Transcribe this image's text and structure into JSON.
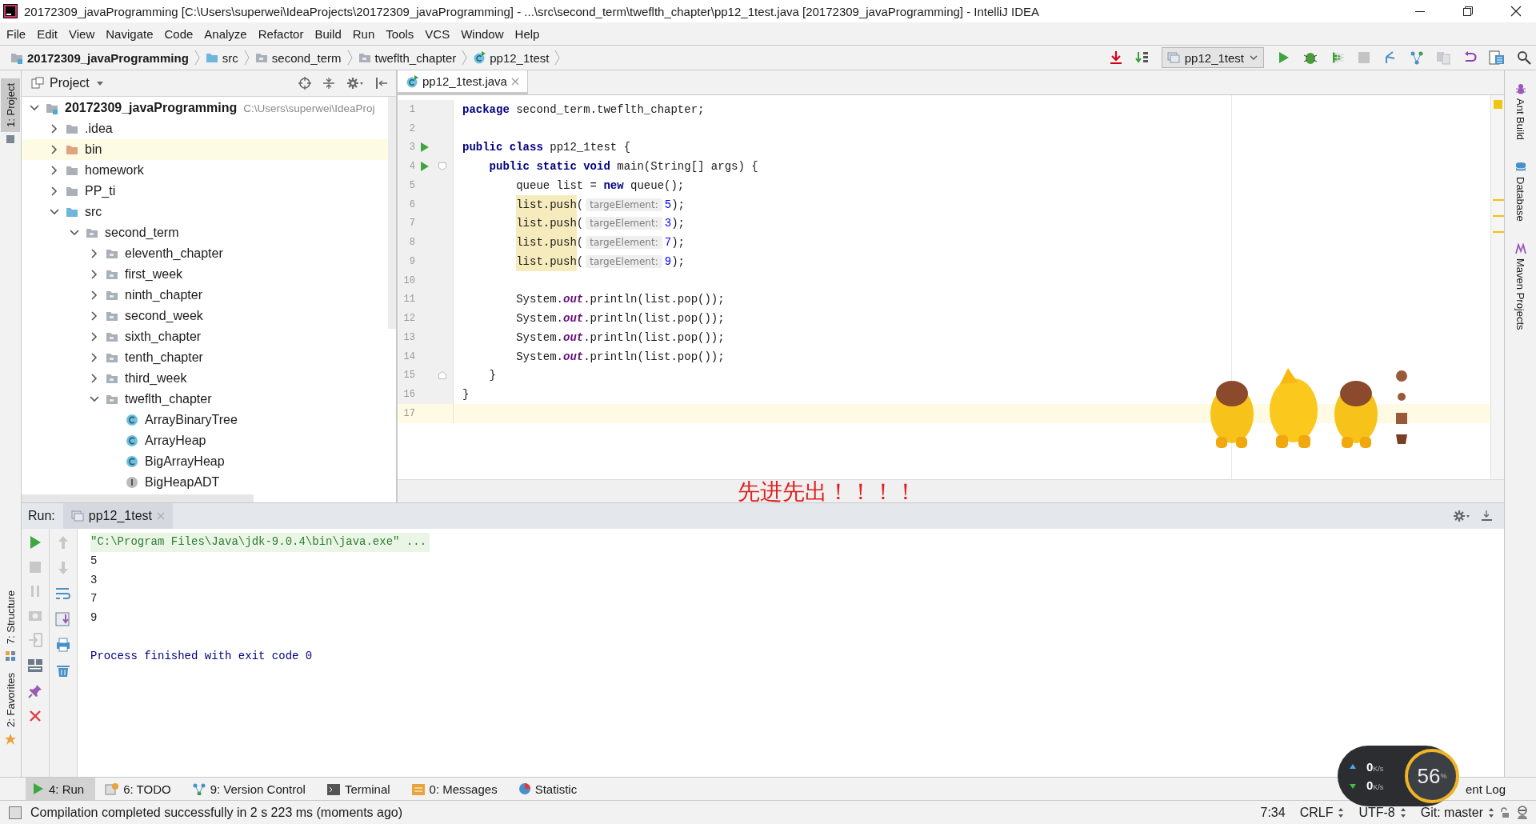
{
  "window": {
    "title": "20172309_javaProgramming [C:\\Users\\superwei\\IdeaProjects\\20172309_javaProgramming] - ...\\src\\second_term\\tweflth_chapter\\pp12_1test.java [20172309_javaProgramming] - IntelliJ IDEA"
  },
  "menu": [
    "File",
    "Edit",
    "View",
    "Navigate",
    "Code",
    "Analyze",
    "Refactor",
    "Build",
    "Run",
    "Tools",
    "VCS",
    "Window",
    "Help"
  ],
  "breadcrumbs": [
    {
      "label": "20172309_javaProgramming",
      "kind": "project"
    },
    {
      "label": "src",
      "kind": "source"
    },
    {
      "label": "second_term",
      "kind": "package"
    },
    {
      "label": "tweflth_chapter",
      "kind": "package"
    },
    {
      "label": "pp12_1test",
      "kind": "class"
    }
  ],
  "run_config": {
    "label": "pp12_1test"
  },
  "left_strip": [
    {
      "label": "1: Project",
      "selected": true,
      "kind": "top"
    },
    {
      "label": "7: Structure",
      "selected": false,
      "kind": "bottom"
    },
    {
      "label": "2: Favorites",
      "selected": false,
      "kind": "bottom"
    }
  ],
  "project_panel": {
    "title": "Project",
    "tree": [
      {
        "label": "20172309_javaProgramming",
        "kind": "module",
        "path": "C:\\Users\\superwei\\IdeaProj",
        "expanded": true,
        "highlighted": false,
        "children": [
          {
            "label": ".idea",
            "kind": "folder",
            "expanded": false,
            "highlighted": false
          },
          {
            "label": "bin",
            "kind": "excluded",
            "expanded": false,
            "highlighted": true
          },
          {
            "label": "homework",
            "kind": "folder",
            "expanded": false,
            "highlighted": false
          },
          {
            "label": "PP_ti",
            "kind": "folder",
            "expanded": false,
            "highlighted": false
          },
          {
            "label": "src",
            "kind": "source",
            "expanded": true,
            "highlighted": false,
            "children": [
              {
                "label": "second_term",
                "kind": "package",
                "expanded": true,
                "highlighted": false,
                "children": [
                  {
                    "label": "eleventh_chapter",
                    "kind": "package",
                    "expanded": false,
                    "highlighted": false
                  },
                  {
                    "label": "first_week",
                    "kind": "package",
                    "expanded": false,
                    "highlighted": false
                  },
                  {
                    "label": "ninth_chapter",
                    "kind": "package",
                    "expanded": false,
                    "highlighted": false
                  },
                  {
                    "label": "second_week",
                    "kind": "package",
                    "expanded": false,
                    "highlighted": false
                  },
                  {
                    "label": "sixth_chapter",
                    "kind": "package",
                    "expanded": false,
                    "highlighted": false
                  },
                  {
                    "label": "tenth_chapter",
                    "kind": "package",
                    "expanded": false,
                    "highlighted": false
                  },
                  {
                    "label": "third_week",
                    "kind": "package",
                    "expanded": false,
                    "highlighted": false
                  },
                  {
                    "label": "tweflth_chapter",
                    "kind": "package",
                    "expanded": true,
                    "highlighted": false,
                    "children": [
                      {
                        "label": "ArrayBinaryTree",
                        "kind": "class",
                        "highlighted": false
                      },
                      {
                        "label": "ArrayHeap",
                        "kind": "class",
                        "highlighted": false
                      },
                      {
                        "label": "BigArrayHeap",
                        "kind": "class",
                        "highlighted": false
                      },
                      {
                        "label": "BigHeapADT",
                        "kind": "interface",
                        "highlighted": false
                      }
                    ]
                  }
                ]
              }
            ]
          }
        ]
      }
    ]
  },
  "editor": {
    "tabs": [
      {
        "label": "pp12_1test.java",
        "selected": true
      }
    ],
    "lines": [
      {
        "number": "1",
        "run_marker": false,
        "fold": false,
        "current": false,
        "tokens": [
          {
            "kind": "keyword",
            "text": "package"
          },
          {
            "kind": "plain",
            "text": " second_term.tweflth_chapter;"
          }
        ]
      },
      {
        "number": "2",
        "run_marker": false,
        "fold": false,
        "current": false
      },
      {
        "number": "3",
        "run_marker": true,
        "fold": false,
        "current": false,
        "tokens": [
          {
            "kind": "keyword",
            "text": "public class"
          },
          {
            "kind": "plain",
            "text": " pp12_1test {"
          }
        ],
        "children": [
          {
            "number": "4",
            "run_marker": true,
            "fold": true,
            "current": false,
            "tokens": [
              {
                "kind": "keyword",
                "text": "public static void"
              },
              {
                "kind": "plain",
                "text": " main(String[] args) {"
              }
            ],
            "children": [
              {
                "number": "5",
                "run_marker": false,
                "fold": false,
                "current": false,
                "tokens": [
                  {
                    "kind": "plain",
                    "text": "queue list = "
                  },
                  {
                    "kind": "keyword",
                    "text": "new"
                  },
                  {
                    "kind": "plain",
                    "text": " queue();"
                  }
                ]
              },
              {
                "number": "6",
                "run_marker": false,
                "fold": false,
                "current": false,
                "tokens": [
                  {
                    "kind": "usage",
                    "text": "list.push"
                  },
                  {
                    "kind": "plain",
                    "text": "("
                  },
                  {
                    "kind": "hint",
                    "text": "targeElement:"
                  },
                  {
                    "kind": "number",
                    "text": "5"
                  },
                  {
                    "kind": "plain",
                    "text": ");"
                  }
                ]
              },
              {
                "number": "7",
                "run_marker": false,
                "fold": false,
                "current": false,
                "tokens": [
                  {
                    "kind": "usage",
                    "text": "list.push"
                  },
                  {
                    "kind": "plain",
                    "text": "("
                  },
                  {
                    "kind": "hint",
                    "text": "targeElement:"
                  },
                  {
                    "kind": "number",
                    "text": "3"
                  },
                  {
                    "kind": "plain",
                    "text": ");"
                  }
                ]
              },
              {
                "number": "8",
                "run_marker": false,
                "fold": false,
                "current": false,
                "tokens": [
                  {
                    "kind": "usage",
                    "text": "list.push"
                  },
                  {
                    "kind": "plain",
                    "text": "("
                  },
                  {
                    "kind": "hint",
                    "text": "targeElement:"
                  },
                  {
                    "kind": "number",
                    "text": "7"
                  },
                  {
                    "kind": "plain",
                    "text": ");"
                  }
                ]
              },
              {
                "number": "9",
                "run_marker": false,
                "fold": false,
                "current": false,
                "tokens": [
                  {
                    "kind": "usage",
                    "text": "list.push"
                  },
                  {
                    "kind": "plain",
                    "text": "("
                  },
                  {
                    "kind": "hint",
                    "text": "targeElement:"
                  },
                  {
                    "kind": "number",
                    "text": "9"
                  },
                  {
                    "kind": "plain",
                    "text": ");"
                  }
                ]
              },
              {
                "number": "10",
                "run_marker": false,
                "fold": false,
                "current": false
              },
              {
                "number": "11",
                "run_marker": false,
                "fold": false,
                "current": false,
                "tokens": [
                  {
                    "kind": "plain",
                    "text": "System."
                  },
                  {
                    "kind": "static",
                    "text": "out"
                  },
                  {
                    "kind": "plain",
                    "text": ".println(list.pop());"
                  }
                ]
              },
              {
                "number": "12",
                "run_marker": false,
                "fold": false,
                "current": false,
                "tokens": [
                  {
                    "kind": "plain",
                    "text": "System."
                  },
                  {
                    "kind": "static",
                    "text": "out"
                  },
                  {
                    "kind": "plain",
                    "text": ".println(list.pop());"
                  }
                ]
              },
              {
                "number": "13",
                "run_marker": false,
                "fold": false,
                "current": false,
                "tokens": [
                  {
                    "kind": "plain",
                    "text": "System."
                  },
                  {
                    "kind": "static",
                    "text": "out"
                  },
                  {
                    "kind": "plain",
                    "text": ".println(list.pop());"
                  }
                ]
              },
              {
                "number": "14",
                "run_marker": false,
                "fold": false,
                "current": false,
                "tokens": [
                  {
                    "kind": "plain",
                    "text": "System."
                  },
                  {
                    "kind": "static",
                    "text": "out"
                  },
                  {
                    "kind": "plain",
                    "text": ".println(list.pop());"
                  }
                ]
              }
            ]
          },
          {
            "number": "15",
            "run_marker": false,
            "fold": true,
            "current": false,
            "tokens": [
              {
                "kind": "plain",
                "text": "}"
              }
            ]
          }
        ]
      },
      {
        "number": "16",
        "run_marker": false,
        "fold": false,
        "current": false,
        "tokens": [
          {
            "kind": "plain",
            "text": "}"
          }
        ]
      },
      {
        "number": "17",
        "run_marker": false,
        "fold": false,
        "current": true
      }
    ]
  },
  "overlay_text": "先进先出！！！！",
  "right_strip": [
    {
      "label": "Ant Build",
      "kind": "ant"
    },
    {
      "label": "Database",
      "kind": "database"
    },
    {
      "label": "Maven Projects",
      "kind": "maven"
    }
  ],
  "run_panel": {
    "label": "Run:",
    "tabs": [
      {
        "label": "pp12_1test",
        "selected": true
      }
    ],
    "console": [
      {
        "kind": "command",
        "text": "\"C:\\Program Files\\Java\\jdk-9.0.4\\bin\\java.exe\" ..."
      },
      {
        "kind": "output",
        "text": "5"
      },
      {
        "kind": "output",
        "text": "3"
      },
      {
        "kind": "output",
        "text": "7"
      },
      {
        "kind": "output",
        "text": "9"
      },
      {
        "kind": "exit",
        "text": "Process finished with exit code 0"
      }
    ]
  },
  "tool_tabs": [
    {
      "label": "4: Run",
      "kind": "run",
      "selected": true
    },
    {
      "label": "6: TODO",
      "kind": "todo",
      "selected": false
    },
    {
      "label": "9: Version Control",
      "kind": "vcs",
      "selected": false
    },
    {
      "label": "Terminal",
      "kind": "terminal",
      "selected": false
    },
    {
      "label": "0: Messages",
      "kind": "messages",
      "selected": false
    },
    {
      "label": "Statistic",
      "kind": "statistic",
      "selected": false
    }
  ],
  "event_log": "ent Log",
  "network_meter": {
    "upload": {
      "value": "0",
      "unit": "K/s"
    },
    "download": {
      "value": "0",
      "unit": "K/s"
    },
    "load": {
      "value": "56",
      "unit": "%"
    }
  },
  "status_bar": {
    "message": "Compilation completed successfully in 2 s 223 ms (moments ago)",
    "position": "7:34",
    "line_separator": "CRLF",
    "encoding": "UTF-8",
    "vcs": "Git: master"
  }
}
